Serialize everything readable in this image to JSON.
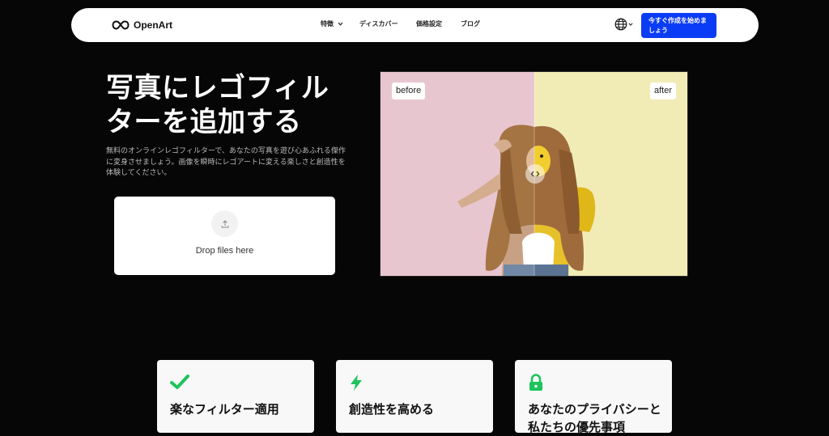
{
  "nav": {
    "logo_text": "OpenArt",
    "links": [
      {
        "label": "特徴",
        "has_dropdown": true
      },
      {
        "label": "ディスカバー"
      },
      {
        "label": "価格設定"
      },
      {
        "label": "ブログ"
      }
    ],
    "language_icon": "globe-icon",
    "cta_label": "今すぐ作成を始めましょう",
    "cta_color": "#0b3cf5"
  },
  "hero": {
    "title": "写真にレゴフィルターを追加する",
    "description": "無料のオンラインレゴフィルターで、あなたの写真を遊び心あふれる傑作に変身させましょう。画像を瞬時にレゴアートに変える楽しさと創造性を体験してください。"
  },
  "upload": {
    "icon": "upload-icon",
    "label": "Drop files here"
  },
  "compare": {
    "before_label": "before",
    "after_label": "after",
    "handle_glyph": "‹ ›"
  },
  "features": [
    {
      "icon": "check-icon",
      "title": "楽なフィルター適用",
      "icon_color": "#1fc35c"
    },
    {
      "icon": "lightning-icon",
      "title": "創造性を高める",
      "icon_color": "#1fc35c"
    },
    {
      "icon": "lock-icon",
      "title": "あなたのプライバシーと私たちの優先事項",
      "icon_color": "#1fc35c"
    }
  ]
}
